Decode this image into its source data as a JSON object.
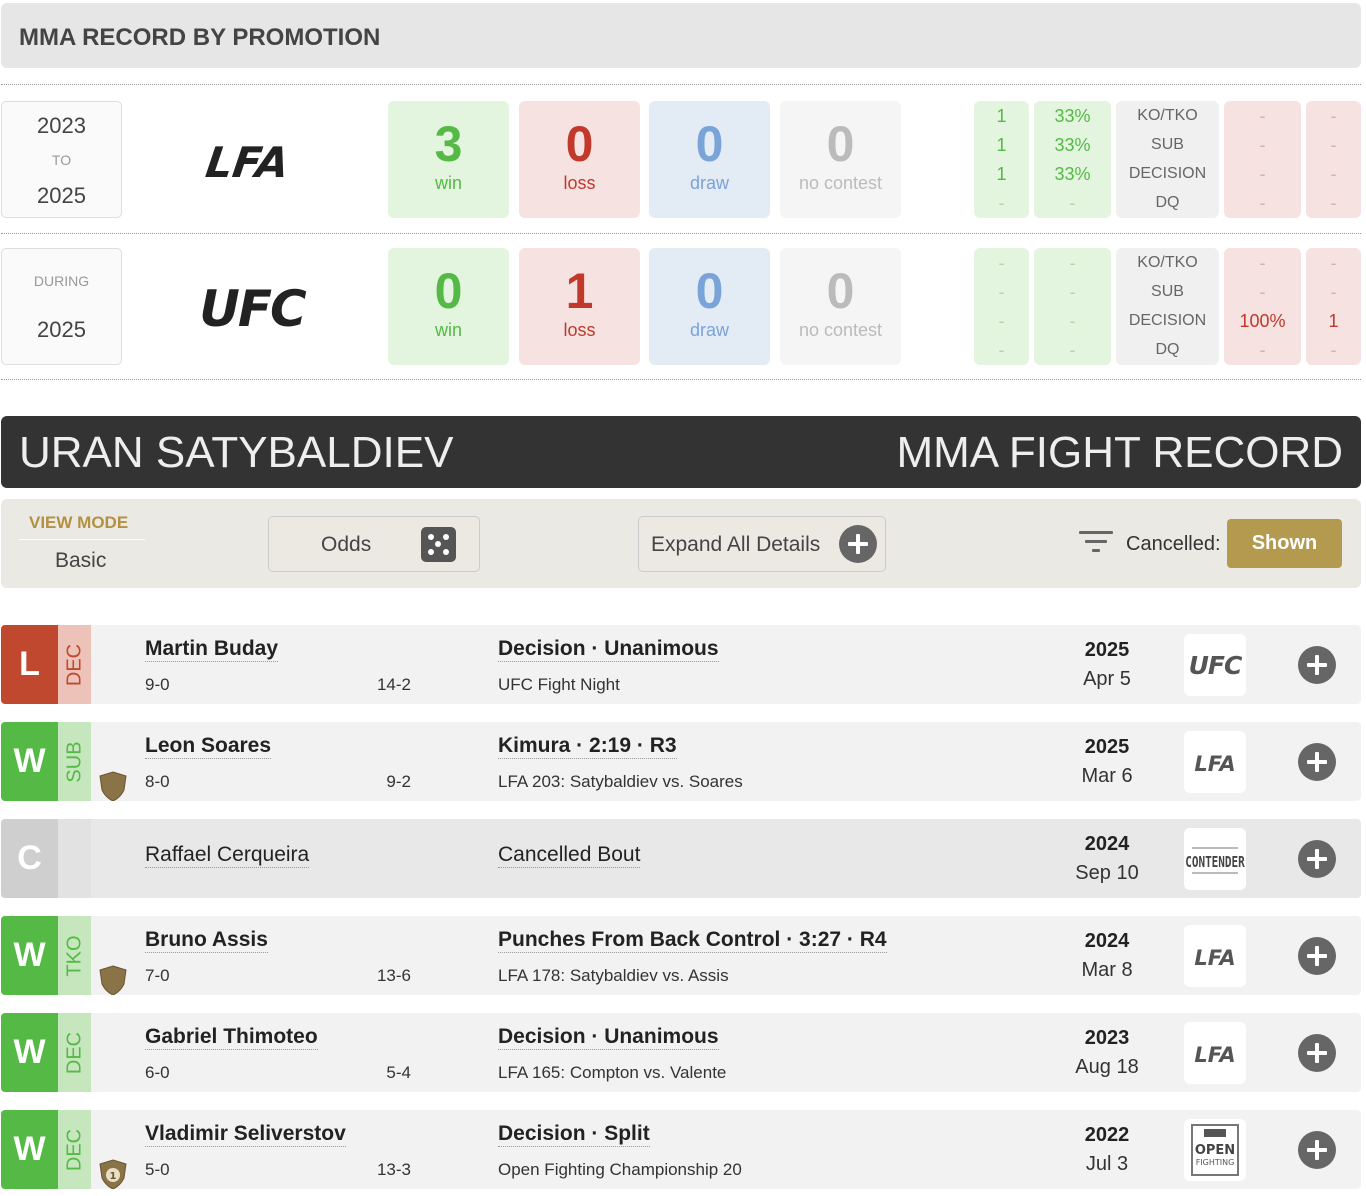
{
  "section_title": "MMA RECORD BY PROMOTION",
  "promotions": [
    {
      "year_from": "2023",
      "year_sep": "TO",
      "year_to": "2025",
      "promotion": "LFA",
      "wins": "3",
      "losses": "0",
      "draws": "0",
      "no_contests": "0",
      "labels": {
        "win": "win",
        "loss": "loss",
        "draw": "draw",
        "nc": "no contest"
      },
      "win_counts": [
        "1",
        "1",
        "1",
        "-"
      ],
      "win_pcts": [
        "33%",
        "33%",
        "33%",
        "-"
      ],
      "methods": [
        "KO/TKO",
        "SUB",
        "DECISION",
        "DQ"
      ],
      "loss_pcts": [
        "-",
        "-",
        "-",
        "-"
      ],
      "loss_counts": [
        "-",
        "-",
        "-",
        "-"
      ]
    },
    {
      "year_label": "DURING",
      "year": "2025",
      "promotion": "UFC",
      "wins": "0",
      "losses": "1",
      "draws": "0",
      "no_contests": "0",
      "labels": {
        "win": "win",
        "loss": "loss",
        "draw": "draw",
        "nc": "no contest"
      },
      "win_counts": [
        "-",
        "-",
        "-",
        "-"
      ],
      "win_pcts": [
        "-",
        "-",
        "-",
        "-"
      ],
      "methods": [
        "KO/TKO",
        "SUB",
        "DECISION",
        "DQ"
      ],
      "loss_pcts": [
        "-",
        "-",
        "100%",
        "-"
      ],
      "loss_counts": [
        "-",
        "-",
        "1",
        "-"
      ]
    }
  ],
  "banner": {
    "fighter": "URAN SATYBALDIEV",
    "title": "MMA FIGHT RECORD"
  },
  "controls": {
    "view_mode_label": "VIEW MODE",
    "view_mode_value": "Basic",
    "odds_label": "Odds",
    "expand_label": "Expand All Details",
    "cancelled_label": "Cancelled:",
    "cancelled_value": "Shown"
  },
  "colors": {
    "win": "#55b946",
    "loss": "#c0482f",
    "draw": "#7aa3d8",
    "accent": "#b39a4e",
    "banner": "#333333"
  },
  "fights": [
    {
      "result": "L",
      "method_short": "DEC",
      "opponent": "Martin Buday",
      "fighter_record": "9-0",
      "opponent_record": "14-2",
      "method": "Decision · Unanimous",
      "event": "UFC Fight Night",
      "year": "2025",
      "date": "Apr 5",
      "promotion": "UFC",
      "badge": ""
    },
    {
      "result": "W",
      "method_short": "SUB",
      "opponent": "Leon Soares",
      "fighter_record": "8-0",
      "opponent_record": "9-2",
      "method": "Kimura · 2:19 · R3",
      "event": "LFA 203: Satybaldiev vs. Soares",
      "year": "2025",
      "date": "Mar 6",
      "promotion": "LFA",
      "badge": "shield"
    },
    {
      "result": "C",
      "method_short": "",
      "opponent": "Raffael Cerqueira",
      "fighter_record": "",
      "opponent_record": "",
      "method": "Cancelled Bout",
      "event": "",
      "year": "2024",
      "date": "Sep 10",
      "promotion": "CONTENDER",
      "badge": ""
    },
    {
      "result": "W",
      "method_short": "TKO",
      "opponent": "Bruno Assis",
      "fighter_record": "7-0",
      "opponent_record": "13-6",
      "method": "Punches From Back Control · 3:27 · R4",
      "event": "LFA 178: Satybaldiev vs. Assis",
      "year": "2024",
      "date": "Mar 8",
      "promotion": "LFA",
      "badge": "shield"
    },
    {
      "result": "W",
      "method_short": "DEC",
      "opponent": "Gabriel Thimoteo",
      "fighter_record": "6-0",
      "opponent_record": "5-4",
      "method": "Decision · Unanimous",
      "event": "LFA 165: Compton vs. Valente",
      "year": "2023",
      "date": "Aug 18",
      "promotion": "LFA",
      "badge": ""
    },
    {
      "result": "W",
      "method_short": "DEC",
      "opponent": "Vladimir Seliverstov",
      "fighter_record": "5-0",
      "opponent_record": "13-3",
      "method": "Decision · Split",
      "event": "Open Fighting Championship 20",
      "year": "2022",
      "date": "Jul 3",
      "promotion": "OPEN FIGHTING",
      "badge": "1"
    }
  ],
  "logos": {
    "lfa": "LFA",
    "ufc": "UFC",
    "contender": "CONTENDER",
    "open_top": "OPEN",
    "open_bottom": "FIGHTING"
  }
}
